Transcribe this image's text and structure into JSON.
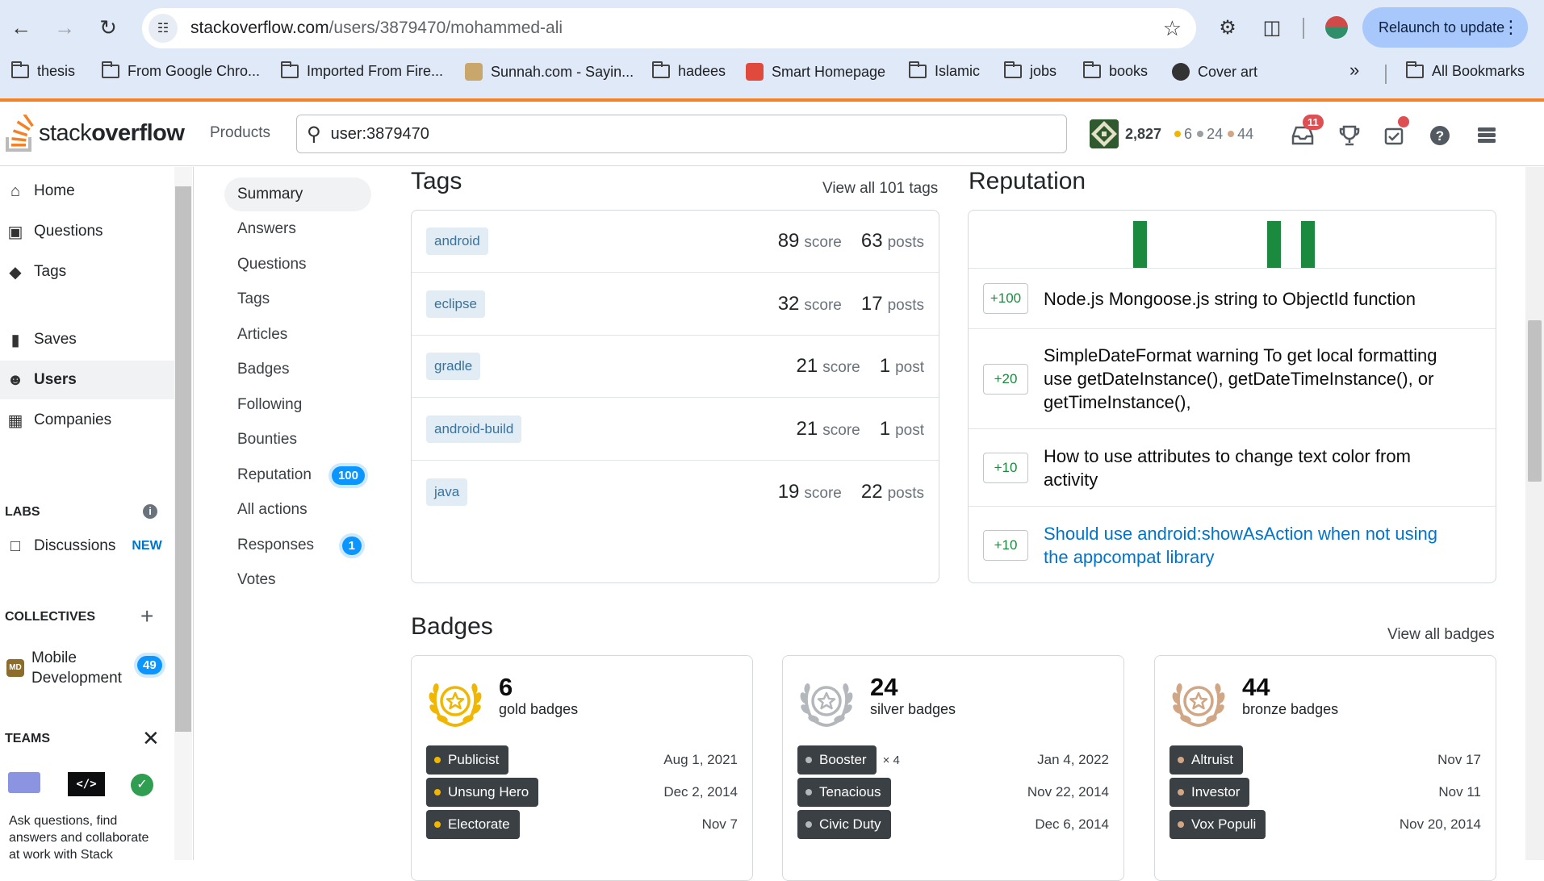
{
  "browser": {
    "url_host": "stackoverflow.com",
    "url_path": "/users/3879470/mohammed-ali",
    "relaunch_label": "Relaunch to update",
    "bookmarks": [
      {
        "label": "thesis",
        "icon": "folder-icon"
      },
      {
        "label": "From Google Chro...",
        "icon": "folder-icon"
      },
      {
        "label": "Imported From Fire...",
        "icon": "folder-icon"
      },
      {
        "label": "Sunnah.com - Sayin...",
        "icon": "book-favicon"
      },
      {
        "label": "hadees",
        "icon": "folder-icon"
      },
      {
        "label": "Smart Homepage",
        "icon": "home-favicon"
      },
      {
        "label": "Islamic",
        "icon": "folder-icon"
      },
      {
        "label": "jobs",
        "icon": "folder-icon"
      },
      {
        "label": "books",
        "icon": "folder-icon"
      },
      {
        "label": "Cover art",
        "icon": "globe-favicon"
      }
    ],
    "more_bookmarks": "»",
    "all_bookmarks": "All Bookmarks"
  },
  "topbar": {
    "logo_prefix": "stack",
    "logo_suffix": "overflow",
    "products": "Products",
    "search_value": "user:3879470",
    "reputation": "2,827",
    "gold": "6",
    "silver": "24",
    "bronze": "44",
    "inbox_count": "11",
    "colors": {
      "gold": "#f1b600",
      "silver": "#9a9fa4",
      "bronze": "#d1a684",
      "accent": "#f48225"
    }
  },
  "leftnav": {
    "items": [
      {
        "label": "Home",
        "icon": "home-icon"
      },
      {
        "label": "Questions",
        "icon": "questions-icon"
      },
      {
        "label": "Tags",
        "icon": "tag-icon"
      },
      {
        "label": "Saves",
        "icon": "bookmark-icon"
      },
      {
        "label": "Users",
        "icon": "users-icon"
      },
      {
        "label": "Companies",
        "icon": "companies-icon"
      }
    ],
    "labs": "LABS",
    "discussions": "Discussions",
    "discussions_badge": "NEW",
    "collectives": "COLLECTIVES",
    "collective_name_1": "Mobile",
    "collective_name_2": "Development",
    "collective_initials": "MD",
    "collective_count": "49",
    "teams": "TEAMS",
    "teams_text_1": "Ask questions, find",
    "teams_text_2": "answers and collaborate",
    "teams_text_3": "at work with Stack"
  },
  "subnav": {
    "items": [
      {
        "label": "Summary"
      },
      {
        "label": "Answers"
      },
      {
        "label": "Questions"
      },
      {
        "label": "Tags"
      },
      {
        "label": "Articles"
      },
      {
        "label": "Badges"
      },
      {
        "label": "Following"
      },
      {
        "label": "Bounties"
      },
      {
        "label": "Reputation",
        "count": "100"
      },
      {
        "label": "All actions"
      },
      {
        "label": "Responses",
        "count": "1"
      },
      {
        "label": "Votes"
      }
    ]
  },
  "tags": {
    "heading": "Tags",
    "view_all": "View all 101 tags",
    "score_word": "score",
    "rows": [
      {
        "name": "android",
        "score": "89",
        "posts": "63",
        "posts_word": "posts"
      },
      {
        "name": "eclipse",
        "score": "32",
        "posts": "17",
        "posts_word": "posts"
      },
      {
        "name": "gradle",
        "score": "21",
        "posts": "1",
        "posts_word": "post"
      },
      {
        "name": "android-build",
        "score": "21",
        "posts": "1",
        "posts_word": "post"
      },
      {
        "name": "java",
        "score": "19",
        "posts": "22",
        "posts_word": "posts"
      }
    ]
  },
  "reputation": {
    "heading": "Reputation",
    "graph_bars": [
      1.0,
      1.0,
      1.0
    ],
    "rows": [
      {
        "delta": "+100",
        "title": "Node.js Mongoose.js string to ObjectId function",
        "link": false
      },
      {
        "delta": "+20",
        "title_1": "SimpleDateFormat warning To get local formatting",
        "title_2": "use getDateInstance(), getDateTimeInstance(), or",
        "title_3": "getTimeInstance(),",
        "link": false
      },
      {
        "delta": "+10",
        "title_1": "How to use attributes to change text color from",
        "title_2": "activity",
        "link": false
      },
      {
        "delta": "+10",
        "title_1": "Should use android:showAsAction when not using",
        "title_2": "the appcompat library",
        "link": true
      }
    ]
  },
  "badges": {
    "heading": "Badges",
    "view_all": "View all badges",
    "cards": [
      {
        "count": "6",
        "kind": "gold badges",
        "color": "#f1b600",
        "items": [
          {
            "name": "Publicist",
            "mult": "",
            "date": "Aug 1, 2021"
          },
          {
            "name": "Unsung Hero",
            "mult": "",
            "date": "Dec 2, 2014"
          },
          {
            "name": "Electorate",
            "mult": "",
            "date": "Nov 7"
          }
        ]
      },
      {
        "count": "24",
        "kind": "silver badges",
        "color": "#b4b8bc",
        "items": [
          {
            "name": "Booster",
            "mult": "× 4",
            "date": "Jan 4, 2022"
          },
          {
            "name": "Tenacious",
            "mult": "",
            "date": "Nov 22, 2014"
          },
          {
            "name": "Civic Duty",
            "mult": "",
            "date": "Dec 6, 2014"
          }
        ]
      },
      {
        "count": "44",
        "kind": "bronze badges",
        "color": "#d1a684",
        "items": [
          {
            "name": "Altruist",
            "mult": "",
            "date": "Nov 17"
          },
          {
            "name": "Investor",
            "mult": "",
            "date": "Nov 11"
          },
          {
            "name": "Vox Populi",
            "mult": "",
            "date": "Nov 20, 2014"
          }
        ]
      }
    ]
  }
}
